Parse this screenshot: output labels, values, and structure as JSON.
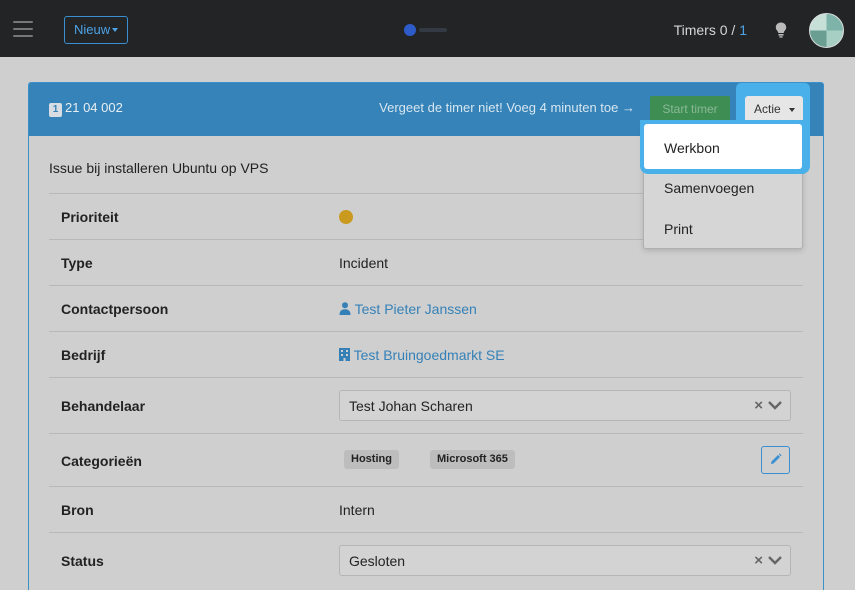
{
  "navbar": {
    "new_button_label": "Nieuw",
    "timers_label": "Timers 0 /",
    "timers_active": "1"
  },
  "ticket": {
    "badge": "1",
    "number": "21 04 002",
    "reminder": "Vergeet de timer niet! Voeg 4 minuten toe →",
    "start_timer_label": "Start timer",
    "action_label": "Actie",
    "subject": "Issue bij installeren Ubuntu op VPS"
  },
  "fields": {
    "priority_label": "Prioriteit",
    "priority_color": "#c99a1e",
    "type_label": "Type",
    "type_value": "Incident",
    "contact_label": "Contactpersoon",
    "contact_value": "Test Pieter Janssen",
    "company_label": "Bedrijf",
    "company_value": "Test Bruingoedmarkt SE",
    "handler_label": "Behandelaar",
    "handler_value": "Test Johan Scharen",
    "categories_label": "Categorieën",
    "categories": [
      "Hosting",
      "Microsoft 365"
    ],
    "source_label": "Bron",
    "source_value": "Intern",
    "status_label": "Status",
    "status_value": "Gesloten"
  },
  "action_menu": {
    "items": [
      "Werkbon",
      "Samenvoegen",
      "Print"
    ],
    "highlighted": "Werkbon"
  },
  "colors": {
    "accent": "#3583b8",
    "link": "#3581b7",
    "highlight": "#49b0ea"
  }
}
